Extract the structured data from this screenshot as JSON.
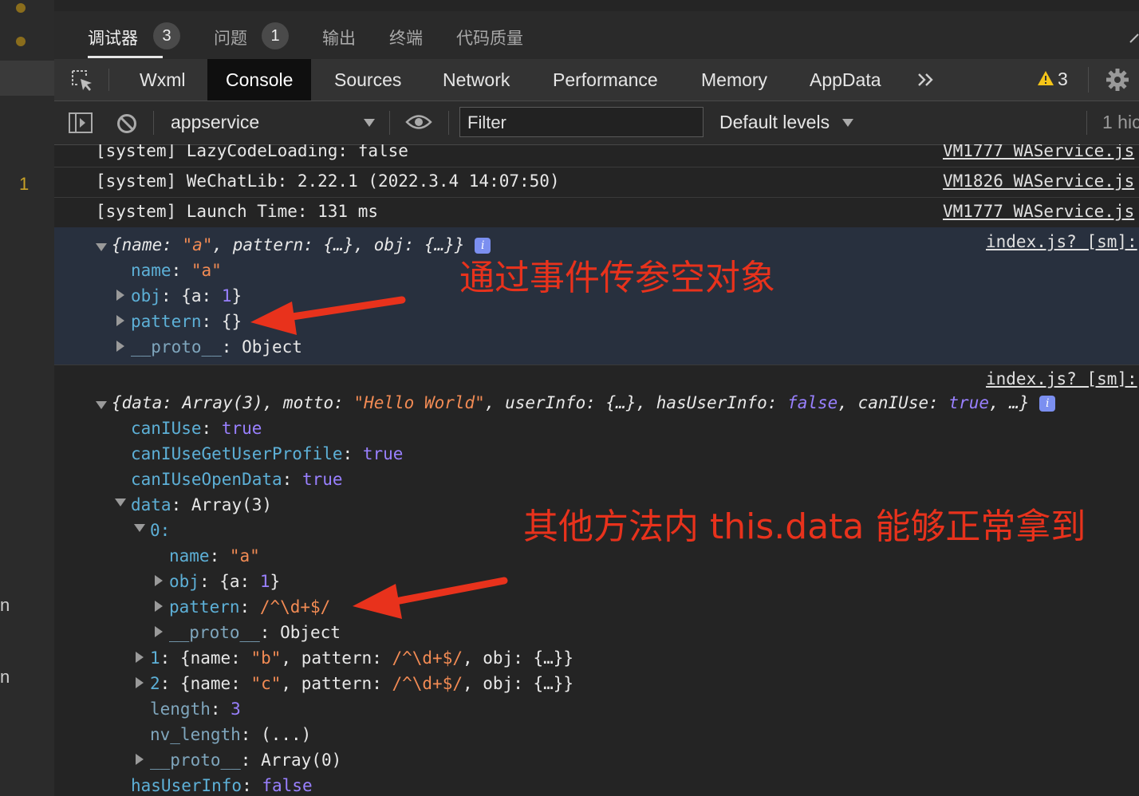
{
  "gutter": {
    "line_number": "1",
    "letter_1": "n",
    "letter_2": "n"
  },
  "panel_tabs": [
    {
      "label": "调试器",
      "badge": "3"
    },
    {
      "label": "问题",
      "badge": "1"
    },
    {
      "label": "输出"
    },
    {
      "label": "终端"
    },
    {
      "label": "代码质量"
    }
  ],
  "devtools_tabs": [
    "Wxml",
    "Console",
    "Sources",
    "Network",
    "Performance",
    "Memory",
    "AppData"
  ],
  "active_devtools_tab": "Console",
  "warning_count": "3",
  "console_toolbar": {
    "context": "appservice",
    "filter_placeholder": "Filter",
    "levels": "Default levels",
    "hidden_count": "1 hic"
  },
  "logs": [
    {
      "text": "[system] LazyCodeLoading: false",
      "source": "VM1777 WAService.js"
    },
    {
      "text": "[system] WeChatLib: 2.22.1 (2022.3.4 14:07:50)",
      "source": "VM1826 WAService.js"
    },
    {
      "text": "[system] Launch Time: 131 ms",
      "source": "VM1777 WAService.js"
    }
  ],
  "obj1": {
    "source": "index.js? [sm]:",
    "summary_open": "{",
    "summary_k1": "name",
    "summary_v1": "\"a\"",
    "summary_mid": ", pattern: {…}, obj: {…}}",
    "name_key": "name",
    "name_val": "\"a\"",
    "obj_key": "obj",
    "obj_val_a": "{a: ",
    "obj_val_1": "1",
    "obj_val_end": "}",
    "pattern_key": "pattern",
    "pattern_val": "{}",
    "proto_key": "__proto__",
    "proto_val": "Object"
  },
  "obj2": {
    "source": "index.js? [sm]:",
    "summary_a": "{data: Array(3), motto: ",
    "summary_motto": "\"Hello World\"",
    "summary_b": ", userInfo: {…}, hasUserInfo: ",
    "summary_false": "false",
    "summary_c": ", canIUse: ",
    "summary_true": "true",
    "summary_d": ", …}",
    "props": [
      {
        "key": "canIUse",
        "val": "true"
      },
      {
        "key": "canIUseGetUserProfile",
        "val": "true"
      },
      {
        "key": "canIUseOpenData",
        "val": "true"
      }
    ],
    "data_key": "data",
    "data_val": "Array(3)",
    "item0_key": "0:",
    "item0_name_key": "name",
    "item0_name_val": "\"a\"",
    "item0_obj_key": "obj",
    "item0_obj_a": "{a: ",
    "item0_obj_1": "1",
    "item0_obj_end": "}",
    "item0_pattern_key": "pattern",
    "item0_pattern_val": "/^\\d+$/",
    "item0_proto_key": "__proto__",
    "item0_proto_val": "Object",
    "item1_key": "1",
    "item1_a": "{name: ",
    "item1_name": "\"b\"",
    "item1_b": ", pattern: ",
    "item1_rx": "/^\\d+$/",
    "item1_c": ", obj: {…}}",
    "item2_key": "2",
    "item2_name": "\"c\"",
    "length_key": "length",
    "length_val": "3",
    "nv_key": "nv_length",
    "nv_val": "(...)",
    "arr_proto_key": "__proto__",
    "arr_proto_val": "Array(0)",
    "has_key": "hasUserInfo",
    "has_val": "false"
  },
  "annotations": {
    "top": "通过事件传参空对象",
    "bottom": "其他方法内 this.data 能够正常拿到"
  },
  "colors": {
    "annotation_red": "#e8321c",
    "key_blue": "#5db0d7",
    "string_orange": "#f28b54",
    "number_purple": "#9980ff",
    "warning_yellow": "#f5c518"
  }
}
